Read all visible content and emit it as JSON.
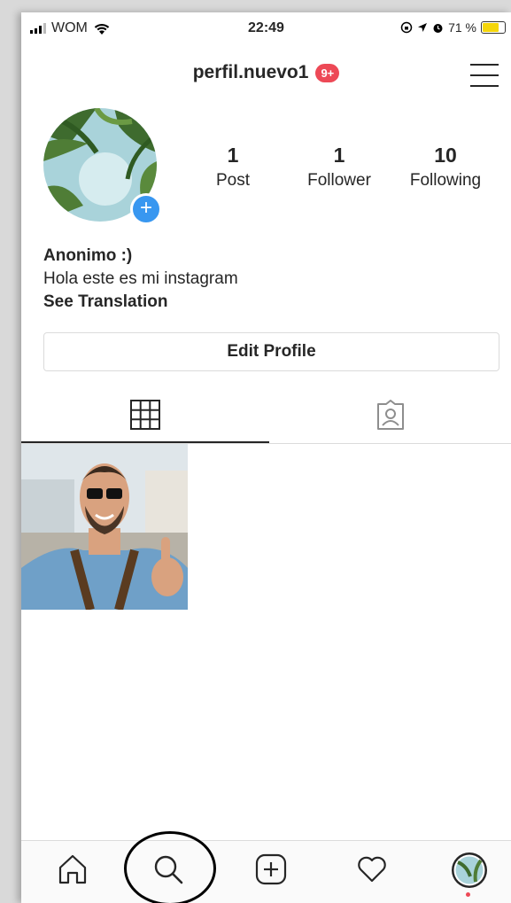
{
  "status_bar": {
    "carrier": "WOM",
    "time": "22:49",
    "battery_percent": "71 %"
  },
  "header": {
    "username": "perfil.nuevo1",
    "notification_badge": "9+"
  },
  "profile": {
    "add_symbol": "+",
    "stats": [
      {
        "value": "1",
        "label": "Post"
      },
      {
        "value": "1",
        "label": "Follower"
      },
      {
        "value": "10",
        "label": "Following"
      }
    ],
    "name": "Anonimo :)",
    "bio": "Hola este es mi instagram",
    "translate_link": "See Translation",
    "edit_button": "Edit Profile"
  },
  "tabs": [
    {
      "icon": "grid-icon",
      "active": true
    },
    {
      "icon": "tagged-icon",
      "active": false
    }
  ],
  "bottom_nav": [
    {
      "icon": "home-icon"
    },
    {
      "icon": "search-icon"
    },
    {
      "icon": "add-post-icon"
    },
    {
      "icon": "heart-icon"
    },
    {
      "icon": "profile-avatar-icon"
    }
  ],
  "colors": {
    "badge_red": "#ed4956",
    "accent_blue": "#3897f0",
    "border_gray": "#dbdbdb",
    "text_dark": "#262626"
  }
}
